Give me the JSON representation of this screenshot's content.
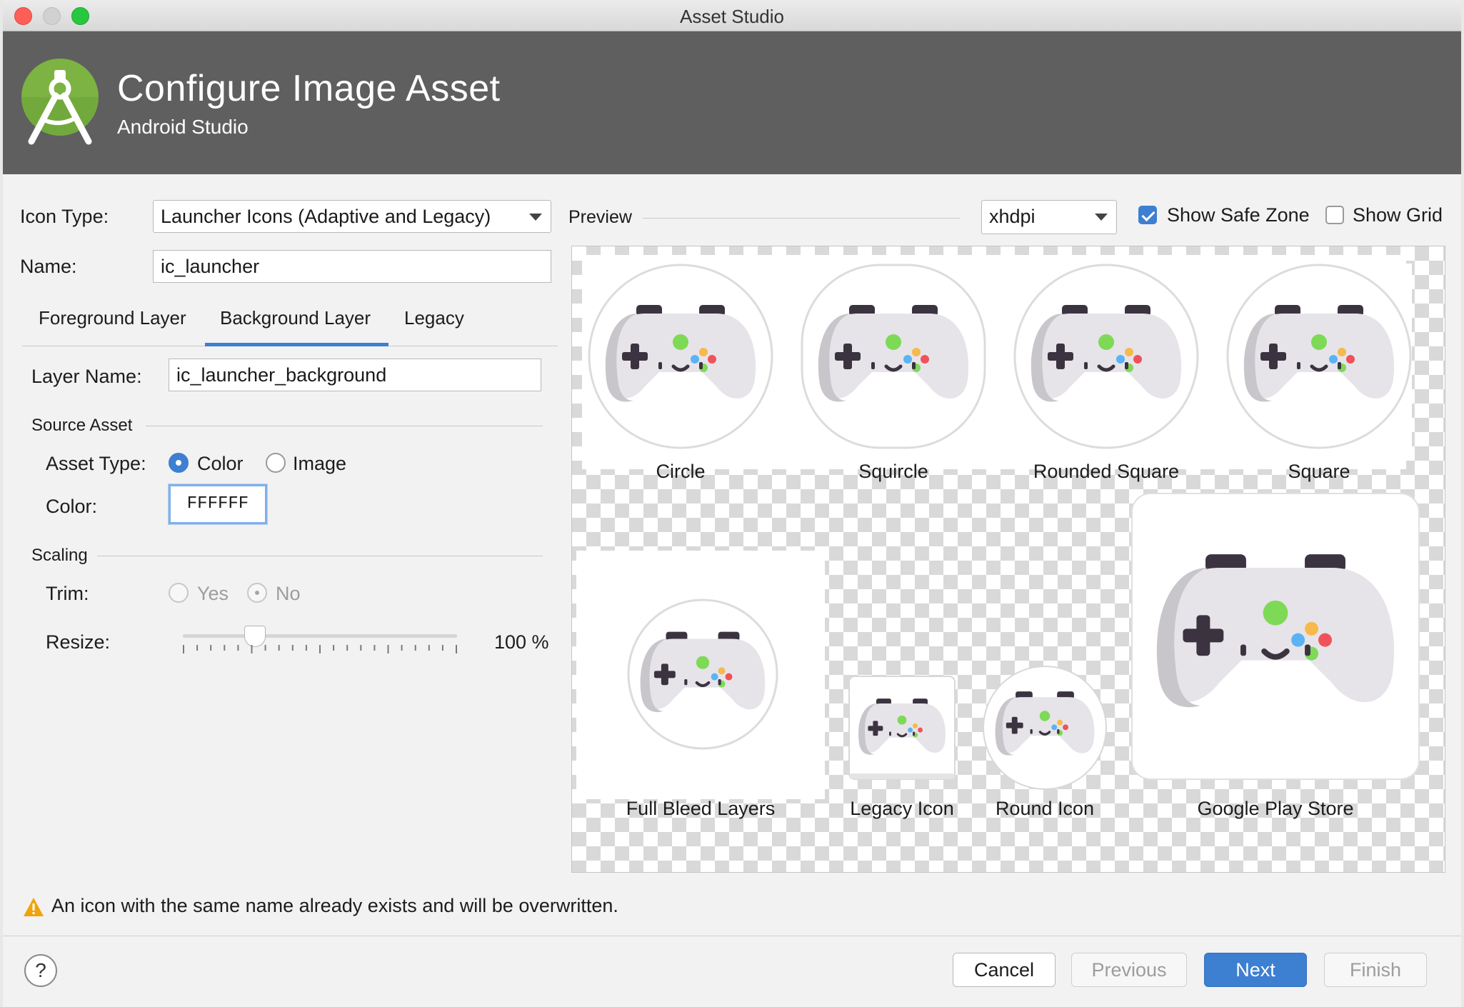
{
  "window": {
    "title": "Asset Studio"
  },
  "header": {
    "title": "Configure Image Asset",
    "subtitle": "Android Studio"
  },
  "form": {
    "icon_type_label": "Icon Type:",
    "icon_type_value": "Launcher Icons (Adaptive and Legacy)",
    "name_label": "Name:",
    "name_value": "ic_launcher"
  },
  "tabs": [
    {
      "label": "Foreground Layer",
      "selected": false
    },
    {
      "label": "Background Layer",
      "selected": true
    },
    {
      "label": "Legacy",
      "selected": false
    }
  ],
  "layer": {
    "layer_name_label": "Layer Name:",
    "layer_name_value": "ic_launcher_background",
    "source_asset_label": "Source Asset",
    "asset_type_label": "Asset Type:",
    "asset_type_options": [
      "Color",
      "Image"
    ],
    "asset_type_selected": "Color",
    "color_label": "Color:",
    "color_value": "FFFFFF",
    "scaling_label": "Scaling",
    "trim_label": "Trim:",
    "trim_options": [
      "Yes",
      "No"
    ],
    "trim_selected": "No",
    "resize_label": "Resize:",
    "resize_value": "100 %",
    "resize_percent": 100
  },
  "preview": {
    "label": "Preview",
    "density": "xhdpi",
    "show_safe_zone_label": "Show Safe Zone",
    "show_safe_zone": true,
    "show_grid_label": "Show Grid",
    "show_grid": false,
    "items": [
      "Circle",
      "Squircle",
      "Rounded Square",
      "Square",
      "Full Bleed Layers",
      "Legacy Icon",
      "Round Icon",
      "Google Play Store"
    ]
  },
  "warning": {
    "icon": "warning-icon",
    "text": "An icon with the same name already exists and will be overwritten."
  },
  "buttons": {
    "help": "?",
    "cancel": "Cancel",
    "previous": "Previous",
    "next": "Next",
    "finish": "Finish"
  },
  "colors": {
    "accent": "#3d7fd1",
    "header_bg": "#5f5f5f",
    "warning": "#f0a30a"
  }
}
